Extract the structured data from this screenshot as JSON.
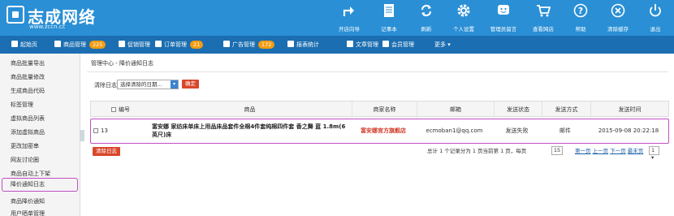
{
  "brand": {
    "name": "志成网络",
    "url": "www.zccn.cc"
  },
  "tools": [
    {
      "label": "开店向导",
      "icon": "share-arrow-icon"
    },
    {
      "label": "记事本",
      "icon": "notepad-icon"
    },
    {
      "label": "刷新",
      "icon": "refresh-icon"
    },
    {
      "label": "个人设置",
      "icon": "gear-icon"
    },
    {
      "label": "管理员留言",
      "icon": "chat-smile-icon"
    },
    {
      "label": "查看网店",
      "icon": "cart-icon"
    },
    {
      "label": "帮助",
      "icon": "help-icon"
    },
    {
      "label": "清除缓存",
      "icon": "close-circle-icon"
    },
    {
      "label": "退出",
      "icon": "power-icon"
    }
  ],
  "nav": {
    "home": "起始页",
    "goods": "商品管理",
    "goods_count": "225",
    "promo": "促销管理",
    "orders": "订单管理",
    "orders_count": "21",
    "ads": "广告管理",
    "ads_count": "172",
    "stats": "报表统计",
    "articles": "文章管理",
    "members": "会员管理",
    "more": "更多"
  },
  "sidebar": {
    "items": [
      "商品批量导出",
      "商品批量修改",
      "生成商品代码",
      "标签管理",
      "虚拟商品列表",
      "添加虚拟商品",
      "更改加密串",
      "网友讨论圈",
      "商品自动上下架",
      "降价通知日志",
      "商品降价通知",
      "用户晒单管理"
    ],
    "active_index": 9
  },
  "breadcrumb": {
    "root": "管理中心",
    "sep": "-",
    "current": "降价通知日志"
  },
  "filter": {
    "label": "清除日志：",
    "select_value": "选择清除的日期...",
    "confirm": "确定"
  },
  "table": {
    "headers": [
      "编号",
      "商品",
      "商家名称",
      "邮箱",
      "发送状态",
      "发送方式",
      "发送时间"
    ],
    "rows": [
      {
        "id": "13",
        "product": "富安娜 家纺床单床上用品床品套件全棉4件套纯棉四件套 香之舞 蓝 1.8m(6英尺)床",
        "store": "富安娜官方旗舰店",
        "email": "ecmoban1@qq.com",
        "status": "发送失败",
        "method": "邮件",
        "time": "2015-09-08 20:22:18"
      }
    ]
  },
  "clear_button": "清除日志",
  "pager": {
    "summary": "总计 1 个记录分为 1 页当前第 1 页，每页",
    "per_page": "15",
    "first": "第一页",
    "prev": "上一页",
    "next": "下一页",
    "last": "最末页",
    "page": "1"
  }
}
